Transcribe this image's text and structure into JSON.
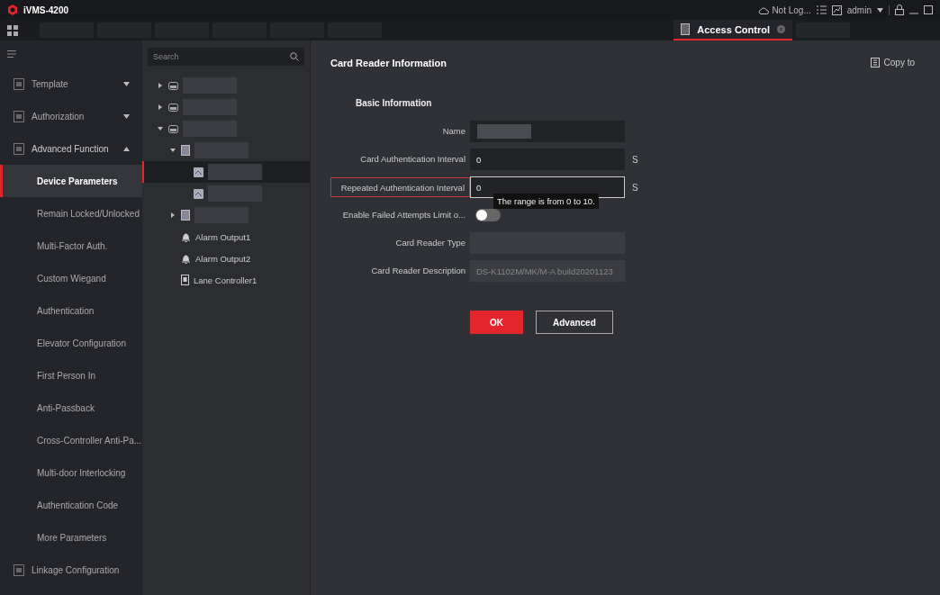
{
  "window": {
    "title": "iVMS-4200",
    "account_status": "Not Log...",
    "user": "admin"
  },
  "tabs": [
    {
      "label": "Access Control",
      "selected": true
    }
  ],
  "sidebar": {
    "items": [
      {
        "label": "Template",
        "expanded": false,
        "selected": false
      },
      {
        "label": "Authorization",
        "expanded": false,
        "selected": false
      },
      {
        "label": "Advanced Function",
        "expanded": true,
        "selected": false,
        "children": [
          {
            "label": "Device Parameters",
            "selected": true
          },
          {
            "label": "Remain Locked/Unlocked",
            "selected": false
          },
          {
            "label": "Multi-Factor Auth.",
            "selected": false
          },
          {
            "label": "Custom Wiegand",
            "selected": false
          },
          {
            "label": "Authentication",
            "selected": false
          },
          {
            "label": "Elevator Configuration",
            "selected": false
          },
          {
            "label": "First Person In",
            "selected": false
          },
          {
            "label": "Anti-Passback",
            "selected": false
          },
          {
            "label": "Cross-Controller Anti-Pa...",
            "selected": false
          },
          {
            "label": "Multi-door Interlocking",
            "selected": false
          },
          {
            "label": "Authentication Code",
            "selected": false
          },
          {
            "label": "More Parameters",
            "selected": false
          }
        ]
      },
      {
        "label": "Linkage Configuration",
        "selected": false
      }
    ]
  },
  "device_tree": {
    "search": {
      "placeholder": "Search"
    },
    "nodes": [
      {
        "kind": "device",
        "expanded": false,
        "selected": false
      },
      {
        "kind": "device",
        "expanded": false,
        "selected": false
      },
      {
        "kind": "device",
        "expanded": true,
        "selected": false,
        "children": [
          {
            "kind": "door",
            "expanded": true,
            "selected": false,
            "children": [
              {
                "kind": "reader",
                "selected": true
              },
              {
                "kind": "reader",
                "selected": false
              }
            ]
          },
          {
            "kind": "door",
            "expanded": false,
            "selected": false
          },
          {
            "kind": "alarm",
            "label": "Alarm Output1",
            "selected": false
          },
          {
            "kind": "alarm",
            "label": "Alarm Output2",
            "selected": false
          },
          {
            "kind": "lane",
            "label": "Lane Controller1",
            "selected": false
          }
        ]
      }
    ]
  },
  "panel": {
    "title": "Card Reader Information",
    "copy_to": "Copy to",
    "section": "Basic Information",
    "fields": [
      {
        "label": "Name",
        "kind": "text",
        "redacted": true,
        "focused": false,
        "invalid": false,
        "disabled": false
      },
      {
        "label": "Card Authentication Interval",
        "kind": "text",
        "value": "0",
        "unit": "S",
        "focused": false,
        "invalid": false,
        "disabled": false
      },
      {
        "label": "Repeated Authentication Interval",
        "kind": "text",
        "value": "0",
        "unit": "S",
        "focused": true,
        "invalid": true,
        "disabled": false,
        "tooltip": "The range is from 0 to 10."
      },
      {
        "label": "Enable Failed Attempts Limit o...",
        "kind": "toggle",
        "on": false
      },
      {
        "label": "Card Reader Type",
        "kind": "text",
        "focused": false,
        "invalid": false,
        "disabled": true
      },
      {
        "label": "Card Reader Description",
        "kind": "text",
        "value": "DS-K1102M/MK/M-A build20201123",
        "focused": false,
        "invalid": false,
        "disabled": true
      }
    ],
    "buttons": [
      {
        "label": "OK",
        "kind": "primary"
      },
      {
        "label": "Advanced",
        "kind": "secondary"
      }
    ]
  }
}
